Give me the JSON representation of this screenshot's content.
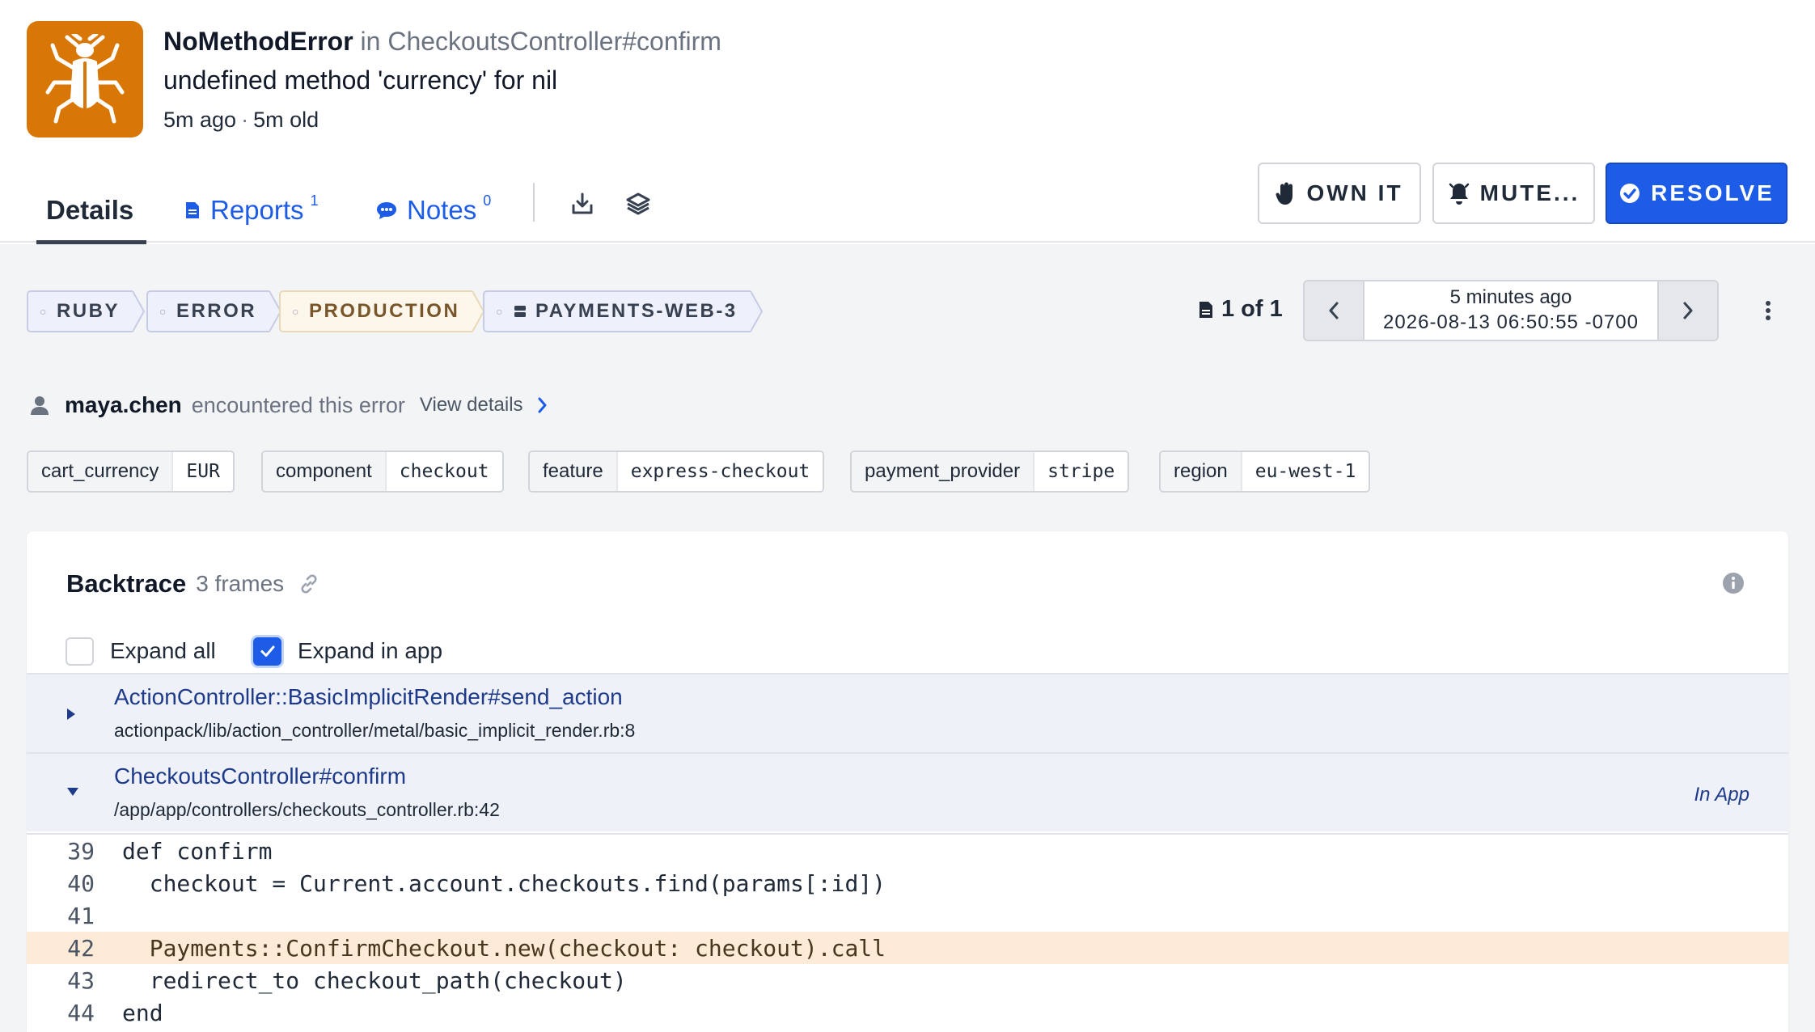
{
  "error": {
    "class": "NoMethodError",
    "location": "in CheckoutsController#confirm",
    "message": "undefined method 'currency' for nil",
    "ago": "5m ago",
    "age": "5m old"
  },
  "tabs": {
    "details": "Details",
    "reports": "Reports",
    "reports_count": "1",
    "notes": "Notes",
    "notes_count": "0"
  },
  "actions": {
    "own": "OWN IT",
    "mute": "MUTE...",
    "resolve": "RESOLVE"
  },
  "tags": [
    "RUBY",
    "ERROR",
    "PRODUCTION",
    "PAYMENTS-WEB-3"
  ],
  "pager": {
    "count": "1 of 1",
    "relative": "5 minutes ago",
    "timestamp": "2026-08-13 06:50:55 -0700"
  },
  "user": {
    "name": "maya.chen",
    "text": "encountered this error",
    "view": "View details"
  },
  "context": [
    {
      "key": "cart_currency",
      "value": "EUR"
    },
    {
      "key": "component",
      "value": "checkout"
    },
    {
      "key": "feature",
      "value": "express-checkout"
    },
    {
      "key": "payment_provider",
      "value": "stripe"
    },
    {
      "key": "region",
      "value": "eu-west-1"
    }
  ],
  "backtrace": {
    "title": "Backtrace",
    "frames_label": "3 frames",
    "expand_all": "Expand all",
    "expand_in_app": "Expand in app",
    "expand_all_checked": false,
    "expand_in_app_checked": true,
    "frames": [
      {
        "fn": "ActionController::BasicImplicitRender#send_action",
        "path": "actionpack/lib/action_controller/metal/basic_implicit_render.rb:8",
        "in_app": "",
        "expanded": false
      },
      {
        "fn": "CheckoutsController#confirm",
        "path": "/app/app/controllers/checkouts_controller.rb:42",
        "in_app": "In App",
        "expanded": true
      }
    ],
    "code": [
      {
        "ln": "39",
        "src": "def confirm"
      },
      {
        "ln": "40",
        "src": "  checkout = Current.account.checkouts.find(params[:id])"
      },
      {
        "ln": "41",
        "src": ""
      },
      {
        "ln": "42",
        "src": "  Payments::ConfirmCheckout.new(checkout: checkout).call"
      },
      {
        "ln": "43",
        "src": "  redirect_to checkout_path(checkout)"
      },
      {
        "ln": "44",
        "src": "end"
      }
    ],
    "highlight_line": "42"
  },
  "colors": {
    "accent": "#1d5ce6",
    "logo": "#d97706",
    "highlight": "#fdebd8"
  },
  "icons": [
    "bug-logo-icon",
    "report-doc-icon",
    "chat-bubble-icon",
    "download-icon",
    "layers-icon",
    "hand-icon",
    "bell-off-icon",
    "check-circle-icon",
    "server-icon",
    "document-icon",
    "chevron-left-icon",
    "chevron-right-icon",
    "kebab-icon",
    "user-icon",
    "link-icon",
    "info-icon",
    "caret-right-icon",
    "caret-down-icon"
  ]
}
